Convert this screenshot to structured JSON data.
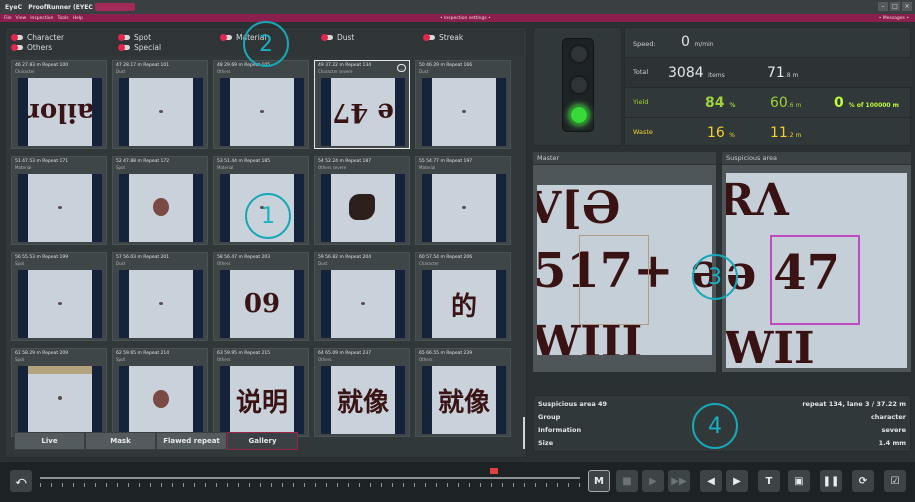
{
  "window": {
    "logo": "EyeC",
    "title": "ProofRunner (EYEC",
    "buttons": [
      "–",
      "□",
      "×"
    ]
  },
  "menu": {
    "items": [
      "File",
      "View",
      "Inspection",
      "Tools",
      "Help"
    ],
    "center": "• Inspection settings •",
    "right": "• Messages •"
  },
  "filters": [
    {
      "label": "Character"
    },
    {
      "label": "Others"
    },
    {
      "label": "Spot"
    },
    {
      "label": "Special"
    },
    {
      "label": "Material"
    },
    {
      "label": "Dust"
    },
    {
      "label": "Streak"
    }
  ],
  "gallery": [
    {
      "line1": "46  27.83 m  Repeat 100",
      "line2": "Character",
      "type": "text",
      "text": "ailor"
    },
    {
      "line1": "47  28.17 m  Repeat 101",
      "line2": "Dust",
      "type": "dot"
    },
    {
      "line1": "48  29.69 m  Repeat 105",
      "line2": "Others",
      "type": "dot"
    },
    {
      "line1": "49  37.22 m  Repeat 134",
      "line2": "Character  severe",
      "type": "text",
      "text": "e 47"
    },
    {
      "line1": "50  46.29 m  Repeat 166",
      "line2": "Dust",
      "type": "dot"
    },
    {
      "line1": "51  47.53 m  Repeat 171",
      "line2": "Material",
      "type": "dot"
    },
    {
      "line1": "52  47.88 m  Repeat 172",
      "line2": "Spot",
      "type": "blob"
    },
    {
      "line1": "53  51.44 m  Repeat 185",
      "line2": "Material",
      "type": "dot"
    },
    {
      "line1": "54  52.24 m  Repeat 187",
      "line2": "Others  severe",
      "type": "bug"
    },
    {
      "line1": "55  54.77 m  Repeat 197",
      "line2": "Material",
      "type": "dot"
    },
    {
      "line1": "56  55.53 m  Repeat 199",
      "line2": "Spot",
      "type": "dot"
    },
    {
      "line1": "57  56.03 m  Repeat 201",
      "line2": "Dust",
      "type": "dot"
    },
    {
      "line1": "58  56.47 m  Repeat 203",
      "line2": "Others",
      "type": "text",
      "text": "09"
    },
    {
      "line1": "59  56.82 m  Repeat 204",
      "line2": "Dust",
      "type": "dot"
    },
    {
      "line1": "60  57.54 m  Repeat 206",
      "line2": "Character",
      "type": "text",
      "text": "的"
    },
    {
      "line1": "61  58.29 m  Repeat 209",
      "line2": "Spot",
      "type": "band"
    },
    {
      "line1": "62  59.65 m  Repeat 214",
      "line2": "Spot",
      "type": "blob"
    },
    {
      "line1": "63  59.95 m  Repeat 215",
      "line2": "Others",
      "type": "text",
      "text": "说明"
    },
    {
      "line1": "64  65.09 m  Repeat 237",
      "line2": "Others",
      "type": "text",
      "text": "就像"
    },
    {
      "line1": "65  66.55 m  Repeat 239",
      "line2": "Others",
      "type": "text",
      "text": "就像"
    }
  ],
  "tabs": [
    "Live",
    "Mask",
    "Flawed repeat",
    "Gallery"
  ],
  "stats": {
    "speed_label": "Speed:",
    "speed_value": "0",
    "speed_unit": "m/min",
    "total_label": "Total",
    "total_items": "3084",
    "total_items_unit": "items",
    "total_m": "71",
    "total_m_unit": ".8 m",
    "yield_label": "Yield",
    "yield_pct": "84",
    "yield_pct_unit": "%",
    "yield_m": "60",
    "yield_m_unit": ".6 m",
    "yield_of": "0",
    "yield_of_unit": "% of 100000 m",
    "waste_label": "Waste",
    "waste_pct": "16",
    "waste_pct_unit": "%",
    "waste_m": "11",
    "waste_m_unit": ".2 m"
  },
  "views": {
    "master_label": "Master",
    "suspicious_label": "Suspicious area",
    "master_line1": "V[Ə",
    "master_line2": "517+ ə",
    "master_line3": "WIII",
    "susp_line1": "RΛ",
    "susp_line2": "ə 47",
    "susp_line3": "WII"
  },
  "details": {
    "title": "Suspicious area 49",
    "title_value": "repeat 134, lane 3 / 37.22 m",
    "group_label": "Group",
    "group_value": "character",
    "info_label": "Information",
    "info_value": "severe",
    "size_label": "Size",
    "size_value": "1.4 mm"
  },
  "toolbar": {
    "mask_btn": "M",
    "text_btn": "T"
  },
  "callouts": [
    "1",
    "2",
    "3",
    "4"
  ],
  "colors": {
    "accent": "#8a1e4c",
    "toggle": "#e2264f",
    "yield": "#9ed33a",
    "waste": "#f2d12a",
    "callout": "#17a8b8",
    "traffic_on": "#38d838",
    "selection_box": "#c04ac0"
  }
}
